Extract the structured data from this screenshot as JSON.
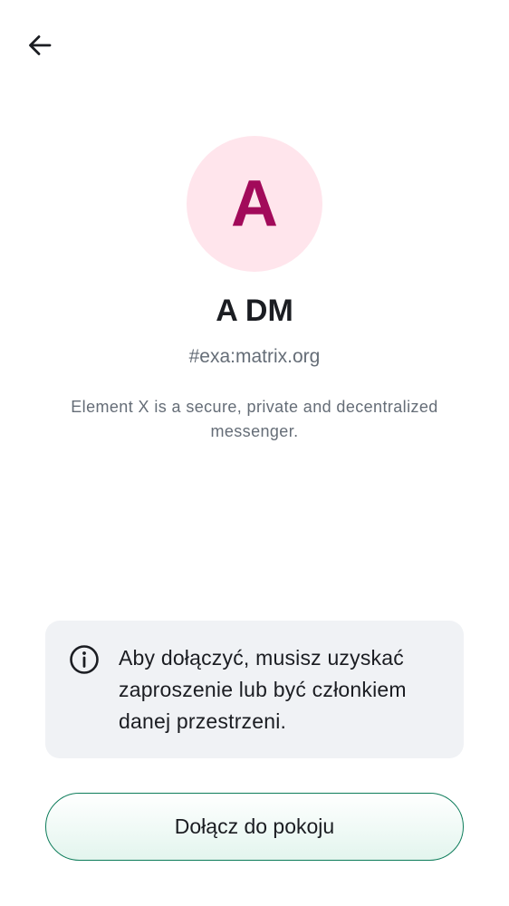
{
  "header": {
    "back_icon": "arrow-left-icon"
  },
  "room": {
    "avatar_letter": "A",
    "avatar_bg_color": "#ffe5ec",
    "avatar_fg_color": "#a20a5a",
    "name": "A DM",
    "alias": "#exa:matrix.org",
    "topic": "Element X is a secure, private and decentralized messenger."
  },
  "info": {
    "icon": "info-icon",
    "message": "Aby dołączyć, musisz uzyskać zaproszenie lub być członkiem danej przestrzeni."
  },
  "actions": {
    "join_label": "Dołącz do pokoju",
    "accent_color": "#0d7c5a"
  }
}
